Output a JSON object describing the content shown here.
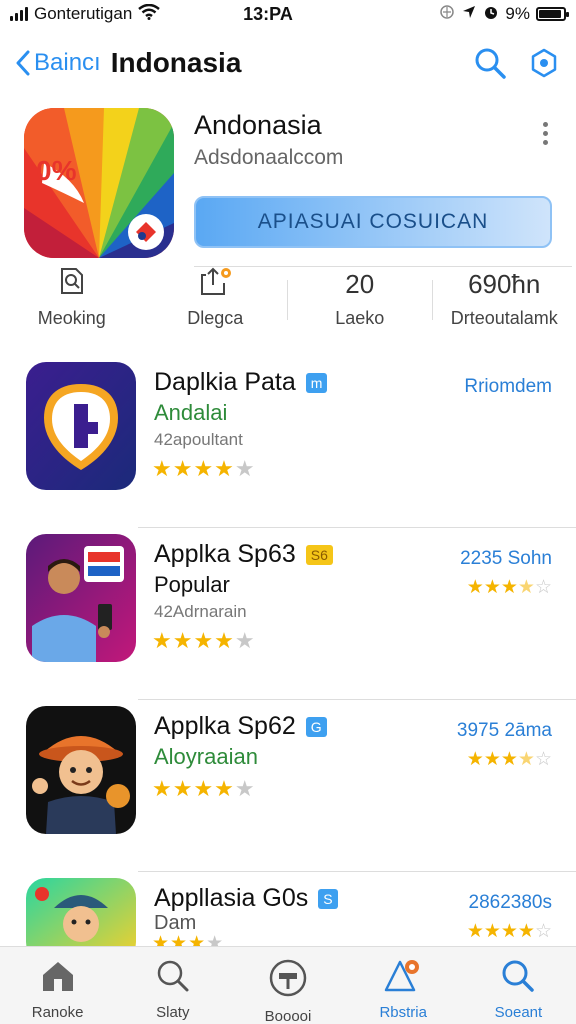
{
  "status_bar": {
    "carrier": "Gonterutigan",
    "time": "13:PA",
    "battery": "9%"
  },
  "nav": {
    "back_label": "Baincı",
    "title": "Indonasia"
  },
  "header_app": {
    "name": "Andonasia",
    "developer": "Adsdonaalccom",
    "get_button": "APIASUAI COSUICAN",
    "accent_color": "#5aa8f3"
  },
  "stats": [
    {
      "top": "",
      "icon": "search-doc-icon",
      "label": "Meoking"
    },
    {
      "top": "",
      "icon": "share-icon",
      "label": "Dlegca"
    },
    {
      "top": "20",
      "label": "Laeko"
    },
    {
      "top": "690ħn",
      "label": "Drteoutalamk"
    }
  ],
  "apps": [
    {
      "title": "Daplkia Pata",
      "badge": "m",
      "badge_color": "blue",
      "subtitle": "Andalai",
      "subtitle_color": "#2e8b3a",
      "meta": "42apoultant",
      "rating": 4,
      "right_text": "Rriomdem",
      "right_rating": null
    },
    {
      "title": "Applka Sp63",
      "badge": "S6",
      "badge_color": "yellow",
      "subtitle": "Popular",
      "subtitle_color": "#111",
      "meta": "42Adrnarain",
      "rating": 4,
      "right_text": "2235 Sohn",
      "right_rating": 3.5
    },
    {
      "title": "Applka Sp62",
      "badge": "G",
      "badge_color": "blue",
      "subtitle": "Aloyraaian",
      "subtitle_color": "#2e8b3a",
      "meta": "",
      "rating": 4,
      "right_text": "3975 2āma",
      "right_rating": 3.5
    },
    {
      "title": "Appllasia G0s",
      "badge": "S",
      "badge_color": "blue",
      "subtitle": "Dam",
      "subtitle_color": "#555",
      "meta": "",
      "rating": 3,
      "right_text": "2862380s",
      "right_rating": 4
    }
  ],
  "tabs": [
    {
      "label": "Ranoke",
      "icon": "home-icon",
      "active": false
    },
    {
      "label": "Slaty",
      "icon": "search-icon",
      "active": false
    },
    {
      "label": "Booooi",
      "icon": "profile-icon",
      "active": false
    },
    {
      "label": "Rbstria",
      "icon": "alert-icon",
      "active": true
    },
    {
      "label": "Soeant",
      "icon": "search-icon",
      "active": true
    }
  ]
}
